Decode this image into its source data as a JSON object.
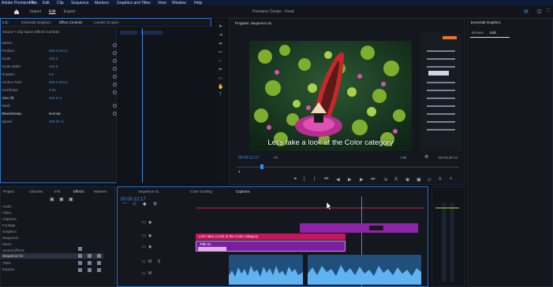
{
  "menubar": {
    "app_name": "Adobe Premiere Pro",
    "items": [
      "File",
      "Edit",
      "Clip",
      "Sequence",
      "Markers",
      "Graphics and Titles",
      "View",
      "Window",
      "Help"
    ]
  },
  "workspace": {
    "tabs": [
      "Import",
      "Edit",
      "Export"
    ],
    "active": "Edit",
    "title": "Premiere Center - Feed"
  },
  "source_panel": {
    "tabs": [
      "Info",
      "Essential Graphics",
      "Effect Controls",
      "Lumetri Scopes"
    ],
    "active_tab": "Effect Controls",
    "header_path": "Source • Clip Name  Effects Controls"
  },
  "effect_rows": {
    "labels": [
      "Motion",
      "Position",
      "Scale",
      "Scale Width",
      "Rotation",
      "Anchor Point",
      "Anti-flicker",
      "Opacity",
      "Mask",
      "Blend Mode",
      "Time Remap",
      "Speed"
    ],
    "values": [
      "",
      "960.0  540.0",
      "100.0",
      "100.0",
      "0.0",
      "960.0  540.0",
      "0.00",
      "100.0 %",
      "",
      "Normal",
      "",
      "100.00 %"
    ]
  },
  "program_monitor": {
    "title": "Program: Sequence 01",
    "caption": "Let's take a look at the Color category",
    "timecode": "00:00:12:17",
    "fit": "Fit",
    "quality": "Full",
    "duration": "00:03:28:14"
  },
  "right_panel": {
    "title": "Essential Graphics",
    "tabs": [
      "Browse",
      "Edit"
    ]
  },
  "project_panel": {
    "tabs": [
      "Project",
      "Libraries",
      "Info",
      "Effects",
      "Markers"
    ],
    "items": [
      "Audio",
      "Video",
      "Captions",
      "Footage",
      "Graphics",
      "Sequence",
      "Music",
      "Sound Effects",
      "Titles",
      "Exports",
      "Sequence 01"
    ]
  },
  "timeline": {
    "tabs": [
      "Sequence 01",
      "Color Grading",
      "Captions"
    ],
    "timecode": "00:00:12:17",
    "caption_clip": "Let's take a look at the Color category",
    "title_clip": "Title 01"
  },
  "colors": {
    "accent": "#2a6fc2",
    "caption_clip": "#c2185b",
    "graphic_clip": "#8e24aa",
    "audio_clip": "#2b6fa8"
  }
}
